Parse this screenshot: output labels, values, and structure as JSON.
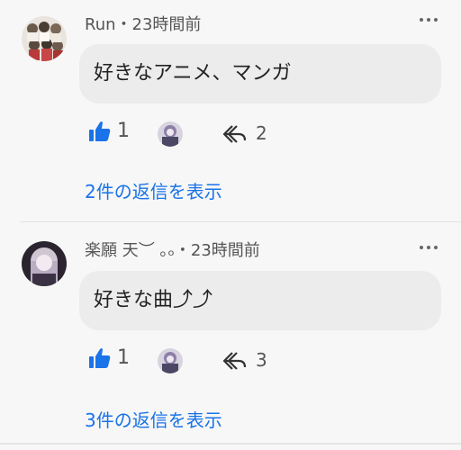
{
  "comments": [
    {
      "author": "Run",
      "separator": "・",
      "time": "23時間前",
      "text": "好きなアニメ、マンガ",
      "likes": "1",
      "replies": "2",
      "replies_link": "2件の返信を表示"
    },
    {
      "author": "楽願 天︶ ｡ₒ",
      "separator": "・",
      "time": "23時間前",
      "text": "好きな曲⤴︎⤴︎",
      "likes": "1",
      "replies": "3",
      "replies_link": "3件の返信を表示"
    }
  ],
  "icons": {
    "like": "thumbs-up-icon",
    "reply": "reply-arrow-icon",
    "more": "more-options-icon"
  },
  "colors": {
    "accent": "#1a73e8",
    "bubble": "#ececec",
    "background": "#f7f7f7"
  }
}
